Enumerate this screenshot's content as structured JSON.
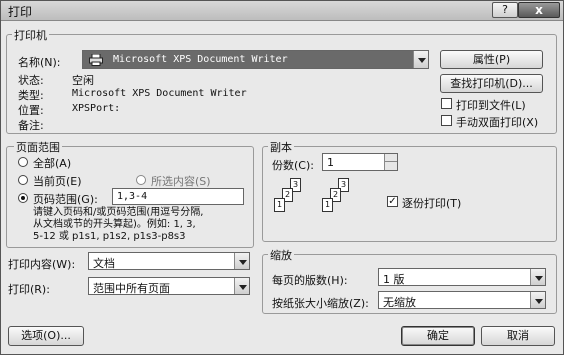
{
  "window": {
    "title": "打印",
    "help_label": "?",
    "close_label": "x"
  },
  "printer": {
    "group_title": "打印机",
    "name_label": "名称(N):",
    "selected_printer": "Microsoft XPS Document Writer",
    "properties_button": "属性(P)",
    "find_printer_button": "查找打印机(D)...",
    "status_label": "状态:",
    "status_value": "空闲",
    "type_label": "类型:",
    "type_value": "Microsoft XPS Document Writer",
    "location_label": "位置:",
    "location_value": "XPSPort:",
    "comment_label": "备注:",
    "print_to_file_label": "打印到文件(L)",
    "manual_duplex_label": "手动双面打印(X)"
  },
  "page_range": {
    "group_title": "页面范围",
    "all_label": "全部(A)",
    "current_label": "当前页(E)",
    "selection_label": "所选内容(S)",
    "pages_label": "页码范围(G):",
    "pages_value": "1,3-4",
    "hint_line1": "请键入页码和/或页码范围(用逗号分隔,",
    "hint_line2": "从文档或节的开头算起)。例如: 1, 3,",
    "hint_line3": "5-12 或 p1s1, p1s2, p1s3-p8s3"
  },
  "print_what": {
    "label": "打印内容(W):",
    "value": "文档"
  },
  "print": {
    "label": "打印(R):",
    "value": "范围中所有页面"
  },
  "copies": {
    "group_title": "副本",
    "count_label": "份数(C):",
    "count_value": "1",
    "collate_label": "逐份打印(T)",
    "collate_checked": true,
    "collate_mark": "✓",
    "page_numbers": [
      "1",
      "2",
      "3"
    ]
  },
  "zoom": {
    "group_title": "缩放",
    "pages_per_sheet_label": "每页的版数(H):",
    "pages_per_sheet_value": "1 版",
    "scale_label": "按纸张大小缩放(Z):",
    "scale_value": "无缩放"
  },
  "footer": {
    "options_button": "选项(O)...",
    "ok_button": "确定",
    "cancel_button": "取消"
  }
}
